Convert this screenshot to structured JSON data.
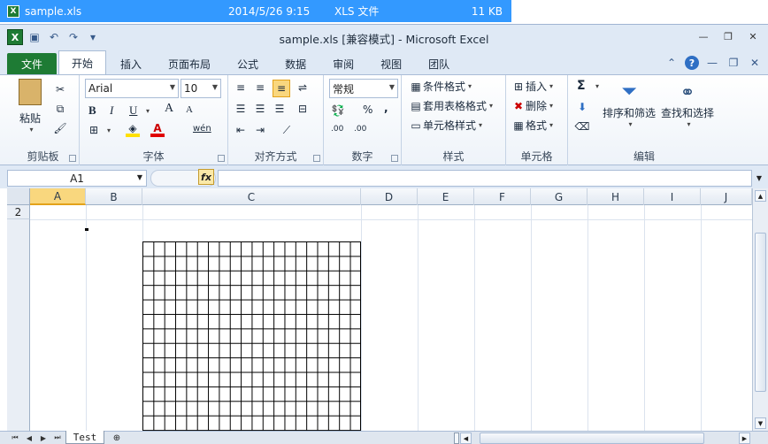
{
  "file_strip": {
    "name": "sample.xls",
    "date": "2014/5/26 9:15",
    "type": "XLS 文件",
    "size": "11 KB",
    "icon": "excel-file-icon"
  },
  "window": {
    "title": "sample.xls  [兼容模式]  -  Microsoft Excel"
  },
  "tabs": [
    {
      "label": "文件"
    },
    {
      "label": "开始"
    },
    {
      "label": "插入"
    },
    {
      "label": "页面布局"
    },
    {
      "label": "公式"
    },
    {
      "label": "数据"
    },
    {
      "label": "审阅"
    },
    {
      "label": "视图"
    },
    {
      "label": "团队"
    }
  ],
  "ribbon": {
    "clipboard": {
      "label": "剪贴板",
      "paste": "粘贴"
    },
    "font": {
      "label": "字体",
      "font_name": "Arial",
      "font_size": "10",
      "bold": "B",
      "italic": "I",
      "underline": "U",
      "grow": "A",
      "shrink": "A",
      "phonetic": "wén"
    },
    "alignment": {
      "label": "对齐方式"
    },
    "number": {
      "label": "数字",
      "format": "常规",
      "percent": "%",
      "comma": ",",
      "inc_decimal": ".00",
      "dec_decimal": ".00"
    },
    "styles": {
      "label": "样式",
      "conditional": "条件格式",
      "table": "套用表格格式",
      "cell_styles": "单元格样式"
    },
    "cells": {
      "label": "单元格",
      "insert": "插入",
      "delete": "删除",
      "format": "格式"
    },
    "editing": {
      "label": "编辑",
      "sort": "排序和筛选",
      "find": "查找和选择",
      "sum": "Σ"
    }
  },
  "formula_bar": {
    "name_box": "A1",
    "fx": "fx",
    "value": ""
  },
  "grid": {
    "columns": [
      "A",
      "B",
      "C",
      "D",
      "E",
      "F",
      "G",
      "H",
      "I",
      "J"
    ],
    "selected_column": "A",
    "row_label": "2"
  },
  "sheets": [
    {
      "name": "Test"
    }
  ],
  "colors": {
    "file_tab": "#1e7b34",
    "selection": "#f9d77e",
    "strip": "#3399ff"
  }
}
